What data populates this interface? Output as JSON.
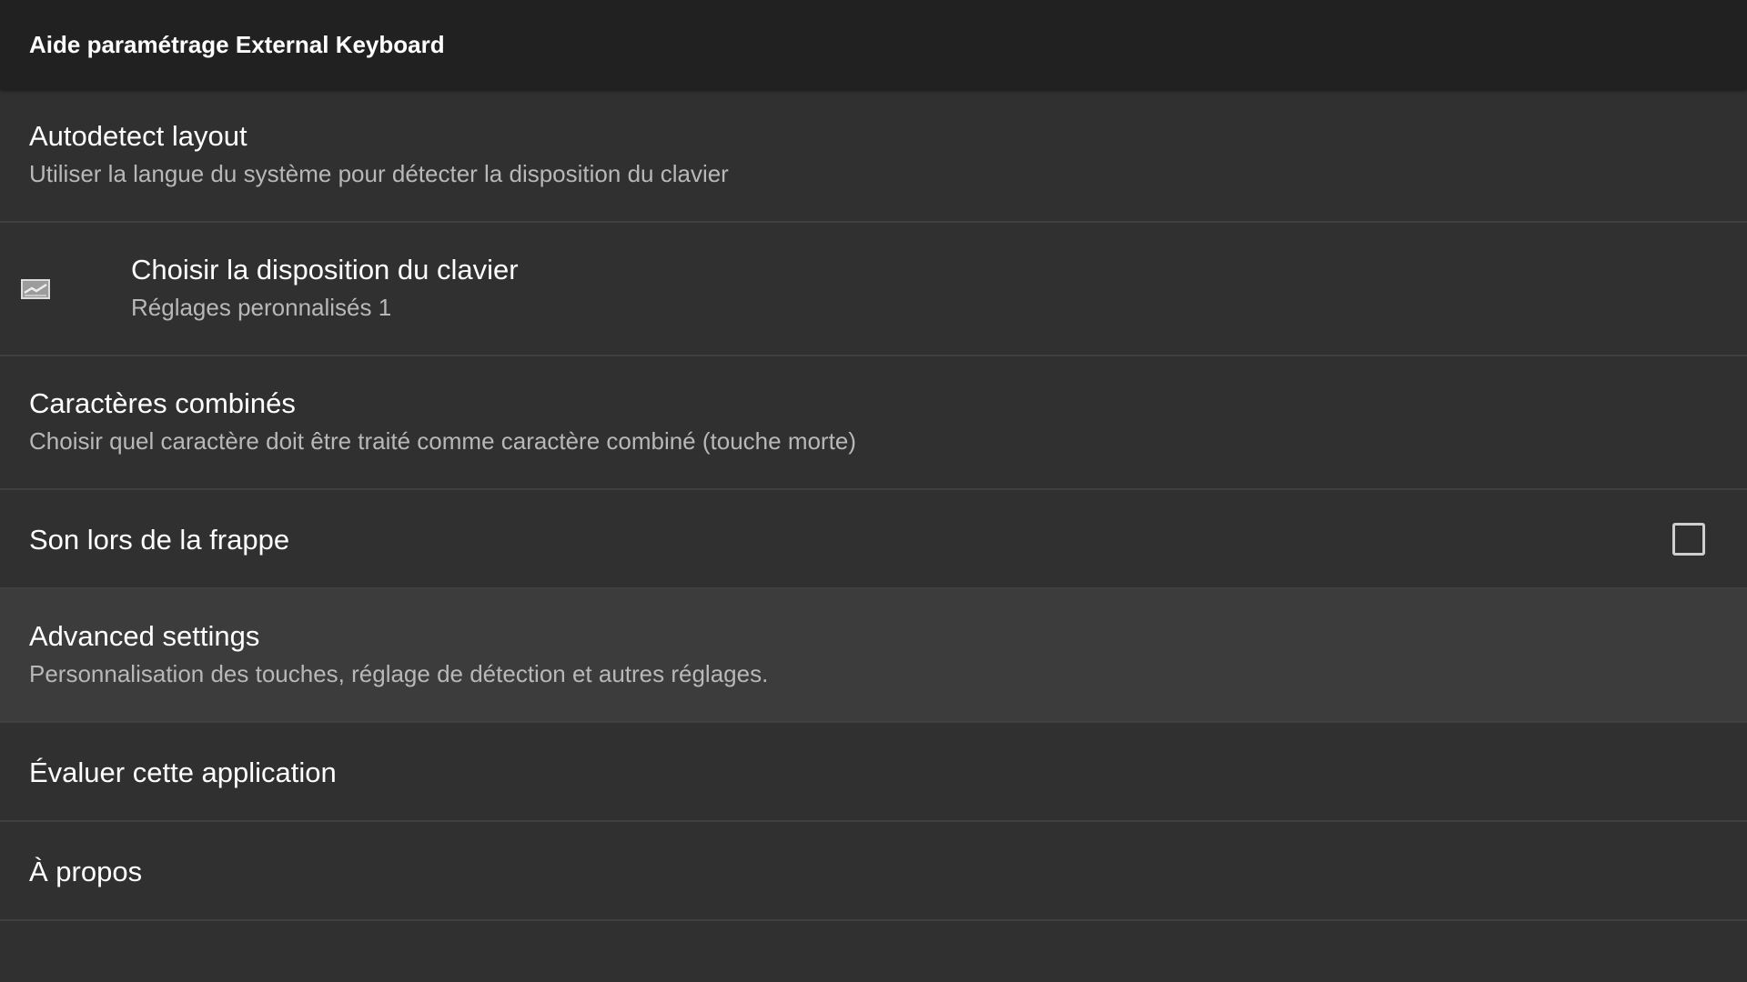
{
  "app_bar": {
    "title": "Aide paramétrage External Keyboard"
  },
  "preferences": [
    {
      "title": "Autodetect layout",
      "summary": "Utiliser la langue du système pour détecter la disposition du clavier"
    },
    {
      "title": "Choisir la disposition du clavier",
      "summary": "Réglages peronnalisés 1",
      "icon": "broken-image-icon"
    },
    {
      "title": "Caractères combinés",
      "summary": "Choisir quel caractère doit être traité comme caractère combiné (touche morte)"
    },
    {
      "title": "Son lors de la frappe",
      "checkbox_checked": false
    },
    {
      "title": "Advanced settings",
      "summary": "Personnalisation des touches, réglage de détection et autres réglages."
    },
    {
      "title": "Évaluer cette application"
    },
    {
      "title": "À propos"
    }
  ],
  "colors": {
    "background": "#303030",
    "app_bar": "#212121",
    "divider": "#3f3f3f",
    "highlight": "#3c3c3c",
    "title_text": "#ffffff",
    "summary_text": "#b8b8b8"
  }
}
